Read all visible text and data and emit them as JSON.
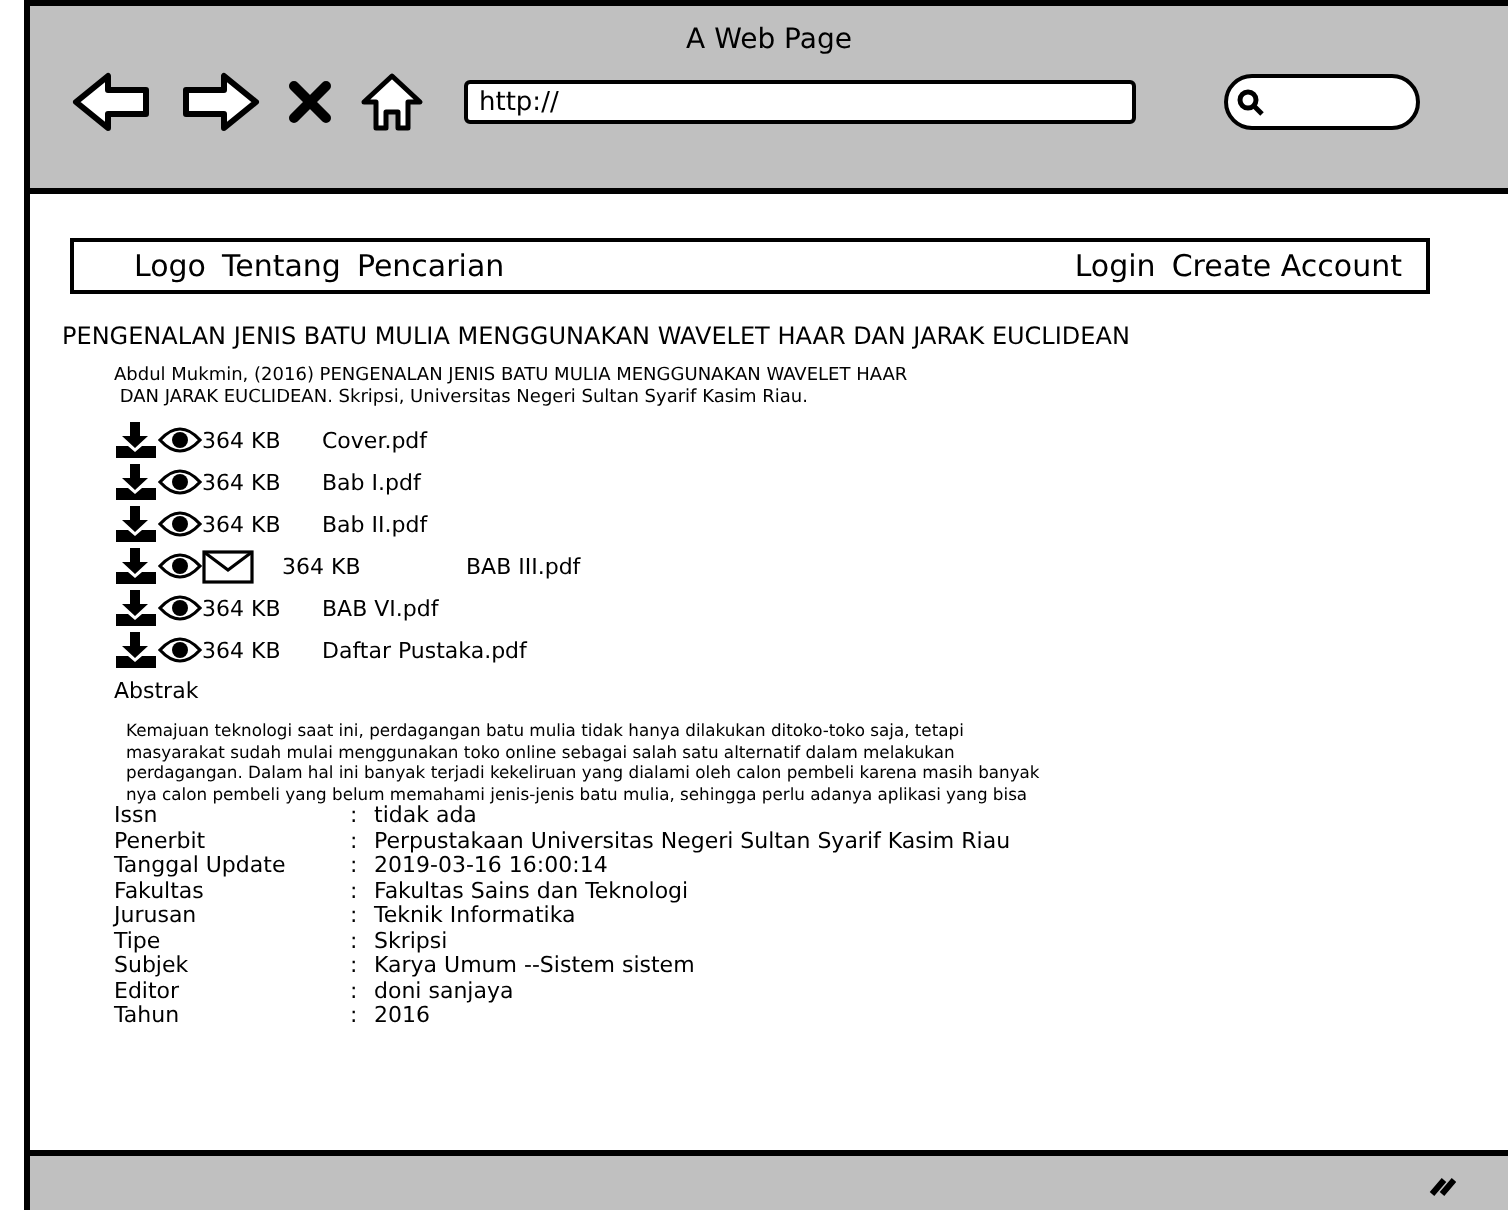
{
  "window": {
    "title": "A Web Page"
  },
  "address_bar": {
    "value": "http://"
  },
  "nav": {
    "left": [
      "Logo",
      "Tentang",
      "Pencarian"
    ],
    "right": [
      "Login",
      "Create Account"
    ]
  },
  "heading": "PENGENALAN JENIS BATU MULIA MENGGUNAKAN WAVELET HAAR DAN JARAK EUCLIDEAN",
  "citation": [
    "Abdul Mukmin, (2016) PENGENALAN JENIS BATU MULIA MENGGUNAKAN WAVELET HAAR",
    "DAN JARAK EUCLIDEAN. Skripsi, Universitas Negeri Sultan Syarif Kasim Riau."
  ],
  "files": [
    {
      "kind": "normal",
      "size": "364 KB",
      "name": "Cover.pdf"
    },
    {
      "kind": "normal",
      "size": "364 KB",
      "name": "Bab I.pdf"
    },
    {
      "kind": "normal",
      "size": "364 KB",
      "name": "Bab II.pdf"
    },
    {
      "kind": "mail",
      "size": "364 KB",
      "name": "BAB III.pdf"
    },
    {
      "kind": "normal",
      "size": "364 KB",
      "name": "BAB VI.pdf"
    },
    {
      "kind": "normal",
      "size": "364 KB",
      "name": "Daftar Pustaka.pdf"
    }
  ],
  "abstract_title": "Abstrak",
  "abstract": [
    "Kemajuan teknologi saat ini, perdagangan batu mulia tidak hanya dilakukan ditoko-toko saja, tetapi",
    "masyarakat sudah mulai menggunakan toko online sebagai salah satu alternatif dalam melakukan",
    "perdagangan. Dalam hal ini banyak terjadi kekeliruan yang dialami oleh calon pembeli karena masih banyak",
    "nya calon pembeli yang belum memahami jenis-jenis batu mulia, sehingga perlu adanya aplikasi yang bisa"
  ],
  "metadata": [
    {
      "label": "Issn",
      "sep": ":",
      "value": "tidak ada"
    },
    {
      "label": "Penerbit",
      "sep": ":",
      "value": "Perpustakaan Universitas Negeri Sultan Syarif Kasim Riau"
    },
    {
      "label": "Tanggal Update",
      "sep": ":",
      "value": "2019-03-16 16:00:14"
    },
    {
      "label": "Fakultas",
      "sep": ":",
      "value": "Fakultas Sains dan Teknologi"
    },
    {
      "label": "Jurusan",
      "sep": ":",
      "value": "Teknik Informatika"
    },
    {
      "label": "Tipe",
      "sep": ":",
      "value": "Skripsi"
    },
    {
      "label": "Subjek",
      "sep": ":",
      "value": "Karya Umum --Sistem sistem"
    },
    {
      "label": "Editor",
      "sep": ":",
      "value": "doni sanjaya"
    },
    {
      "label": "Tahun",
      "sep": ":",
      "value": "2016"
    }
  ]
}
